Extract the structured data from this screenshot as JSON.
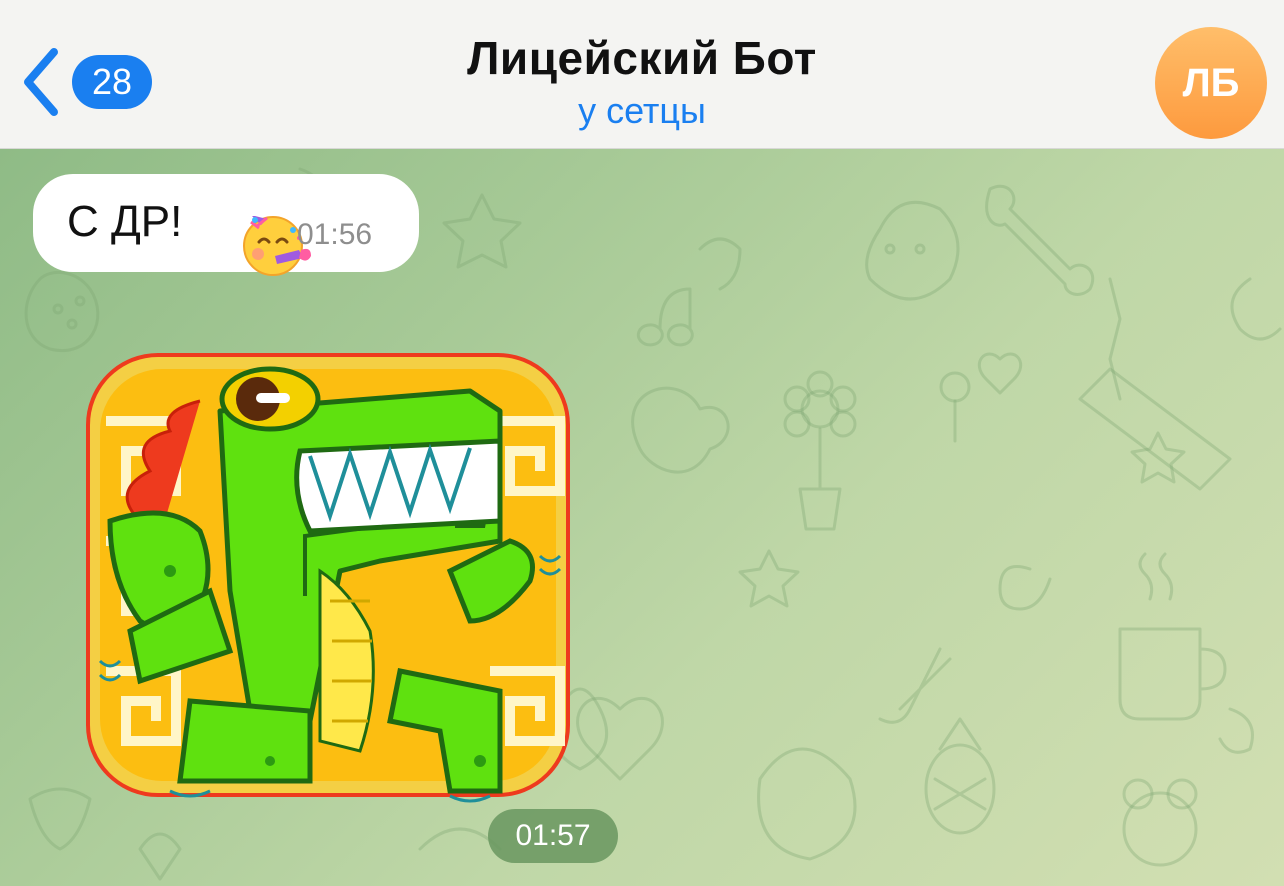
{
  "header": {
    "back_badge_count": "28",
    "title": "Лицейский Бот",
    "subtitle": "у сетцы",
    "avatar_initials": "ЛБ",
    "accent_color": "#1a7ff0",
    "avatar_color": "#fd9a3e"
  },
  "messages": [
    {
      "type": "text",
      "text": "С ДР!",
      "emoji": "partying-face",
      "time": "01:56"
    },
    {
      "type": "sticker",
      "sticker": "green-dinosaur-dancing",
      "time": "01:57"
    }
  ],
  "icons": {
    "back": "chevron-left-icon",
    "emoji": "partying-face-icon",
    "sticker": "dinosaur-sticker"
  }
}
